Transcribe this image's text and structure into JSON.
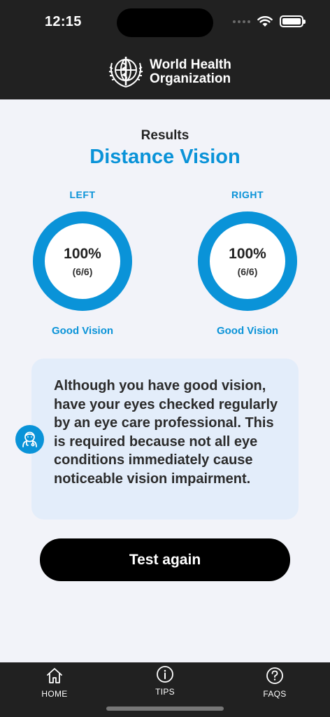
{
  "status_bar": {
    "time": "12:15"
  },
  "header": {
    "logo_line1": "World Health",
    "logo_line2": "Organization"
  },
  "results": {
    "label": "Results",
    "title": "Distance Vision"
  },
  "eyes": [
    {
      "side": "LEFT",
      "percent": "100%",
      "score": "(6/6)",
      "status": "Good Vision",
      "fraction": 1.0
    },
    {
      "side": "RIGHT",
      "percent": "100%",
      "score": "(6/6)",
      "status": "Good Vision",
      "fraction": 1.0
    }
  ],
  "advice": {
    "text": "Although you have good vision, have your eyes checked regularly by an eye care professional. This is required because not all eye conditions immediately cause noticeable vision impairment.",
    "icon": "doctor-icon"
  },
  "actions": {
    "test_again": "Test again"
  },
  "nav": {
    "items": [
      {
        "label": "HOME",
        "icon": "home-icon"
      },
      {
        "label": "TIPS",
        "icon": "info-icon"
      },
      {
        "label": "FAQS",
        "icon": "help-icon"
      }
    ]
  },
  "colors": {
    "accent": "#0a93d8",
    "card": "#e3edfa",
    "dark": "#212121",
    "background": "#f2f3f9"
  }
}
